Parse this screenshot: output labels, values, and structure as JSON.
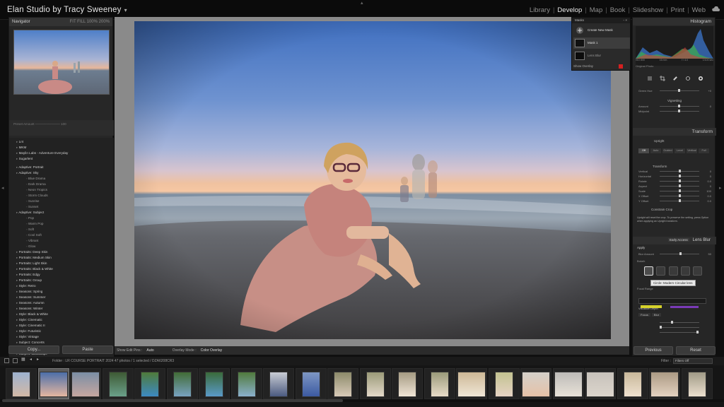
{
  "identity": {
    "title": "Elan Studio by Tracy Sweeney",
    "caret": "▾"
  },
  "modules": [
    {
      "label": "Library",
      "active": false
    },
    {
      "label": "Develop",
      "active": true
    },
    {
      "label": "Map",
      "active": false
    },
    {
      "label": "Book",
      "active": false
    },
    {
      "label": "Slideshow",
      "active": false
    },
    {
      "label": "Print",
      "active": false
    },
    {
      "label": "Web",
      "active": false
    }
  ],
  "navigator": {
    "title": "Navigator",
    "zoom_options": "FIT   FILL   100%   200%"
  },
  "presets": {
    "items": [
      {
        "label": "Lr4",
        "child": false
      },
      {
        "label": "MKM",
        "child": false
      },
      {
        "label": "Maylin Labs - Adventure Everyday",
        "child": false
      },
      {
        "label": "Sugarlent",
        "child": false
      },
      {
        "label": "Adaptive: Portrait",
        "child": false,
        "gap": true
      },
      {
        "label": "Adaptive: Sky",
        "child": false
      },
      {
        "label": "Blue Drama",
        "child": true
      },
      {
        "label": "Dark Drama",
        "child": true
      },
      {
        "label": "Neon Tropics",
        "child": true
      },
      {
        "label": "Storm Clouds",
        "child": true
      },
      {
        "label": "Sunrise",
        "child": true
      },
      {
        "label": "Sunset",
        "child": true
      },
      {
        "label": "Adaptive: Subject",
        "child": false
      },
      {
        "label": "Pop",
        "child": true
      },
      {
        "label": "Warm Pop",
        "child": true
      },
      {
        "label": "Soft",
        "child": true
      },
      {
        "label": "Cool Soft",
        "child": true
      },
      {
        "label": "Vibrant",
        "child": true
      },
      {
        "label": "Glow",
        "child": true
      },
      {
        "label": "Portraits: Deep Skin",
        "child": false
      },
      {
        "label": "Portraits: Medium Skin",
        "child": false
      },
      {
        "label": "Portraits: Light Skin",
        "child": false
      },
      {
        "label": "Portraits: Black & White",
        "child": false
      },
      {
        "label": "Portraits: Edgy",
        "child": false
      },
      {
        "label": "Portraits: Group",
        "child": false
      },
      {
        "label": "Style: Retro",
        "child": false
      },
      {
        "label": "Seasons: Spring",
        "child": false
      },
      {
        "label": "Seasons: Summer",
        "child": false
      },
      {
        "label": "Seasons: Autumn",
        "child": false
      },
      {
        "label": "Seasons: Winter",
        "child": false
      },
      {
        "label": "Style: Black & White",
        "child": false
      },
      {
        "label": "Style: Cinematic",
        "child": false
      },
      {
        "label": "Style: Cinematic II",
        "child": false
      },
      {
        "label": "Style: Futuristic",
        "child": false
      },
      {
        "label": "Style: Vintage",
        "child": false
      },
      {
        "label": "Subject: Concerts",
        "child": false
      },
      {
        "label": "Subject: Food",
        "child": false
      },
      {
        "label": "Subject: Landscape",
        "child": false
      }
    ]
  },
  "left_buttons": {
    "copy": "Copy...",
    "paste": "Paste"
  },
  "toolbar": {
    "show_edit_pins_label": "Show Edit Pins :",
    "show_edit_pins_value": "Auto",
    "overlay_mode_label": "Overlay Mode :",
    "overlay_mode_value": "Color Overlay"
  },
  "masks": {
    "title": "Masks",
    "create": "Create New Mask",
    "mask1": "Mask 1",
    "lens_blur": "Lens Blur",
    "show_overlay": "Show Overlay"
  },
  "right_panel": {
    "histogram_title": "Histogram",
    "hist_meta": [
      "ISO 800",
      "16 mm",
      "f / 4.0",
      "1/100 sec"
    ],
    "original_photo": "Original Photo",
    "vignetting": "Vignetting",
    "transform_title": "Transform",
    "upright": "Upright",
    "transform_section": "Transform",
    "transform_sliders": [
      {
        "name": "Vertical",
        "value": "0",
        "pos": 0.5
      },
      {
        "name": "Horizontal",
        "value": "0",
        "pos": 0.5
      },
      {
        "name": "Rotate",
        "value": "0.0",
        "pos": 0.5
      },
      {
        "name": "Aspect",
        "value": "0",
        "pos": 0.5
      },
      {
        "name": "Scale",
        "value": "100",
        "pos": 0.5
      },
      {
        "name": "X Offset",
        "value": "0.0",
        "pos": 0.5
      },
      {
        "name": "Y Offset",
        "value": "0.0",
        "pos": 0.5
      }
    ],
    "upright_segments": [
      "Off",
      "Auto",
      "Guided",
      "Level",
      "Vertical",
      "Full"
    ],
    "constrain_crop": "Constrain Crop",
    "upright_note": "Upright will reset the crop. To preserve the setting, press Option when applying an Upright transform.",
    "lens_blur_title": "Lens Blur",
    "early_access": "Early Access",
    "apply": "Apply",
    "blur_amount_label": "Blur Amount",
    "blur_amount_value": "50",
    "bokeh_label": "Bokeh",
    "tooltip": "Circle: Modern Circular lens",
    "focal_range": "Focal Range",
    "visualize_depth": "Visualize Depth",
    "focus": "Focus",
    "blur": "Blur",
    "previous": "Previous",
    "reset": "Reset"
  },
  "filmstrip": {
    "source": "Folder : LR COURSE PORTRAIT 2024    47 photos / 1 selected / DZA6208CR3",
    "filter_label": "Filter :",
    "filter_value": "Filters Off",
    "selected_index": 1
  },
  "colors": {
    "accent": "#e8e8e8",
    "panel": "#262626",
    "overlay_red": "#d42020"
  }
}
